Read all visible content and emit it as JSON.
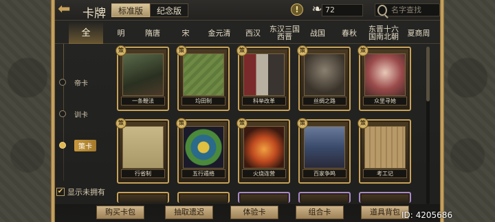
{
  "header": {
    "title": "卡牌",
    "editions": [
      "标准版",
      "纪念版"
    ],
    "count": "72",
    "search_placeholder": "名字查找"
  },
  "eras": [
    "全",
    "明",
    "隋唐",
    "宋",
    "金元清",
    "西汉",
    "东汉三国\n西晋",
    "战国",
    "春秋",
    "东晋十六\n国南北朝",
    "夏商周"
  ],
  "categories": [
    "帝卡",
    "训卡",
    "策卡"
  ],
  "active_category": "策卡",
  "show_unowned_label": "显示未拥有",
  "cards_row1": [
    "一条鞭法",
    "均田制",
    "科举改革",
    "丝绸之路",
    "众里寻她"
  ],
  "cards_row2": [
    "行省制",
    "五行遁络",
    "火烧连营",
    "百家争鸣",
    "考工记"
  ],
  "bottom_buttons": [
    "购买卡包",
    "抽取遗迟",
    "体验卡",
    "组合卡",
    "道具背包"
  ],
  "user_id": "ID: 4205686",
  "colors": {
    "gold": "#c9a35a",
    "panel": "#252523",
    "accent": "#d8b060"
  }
}
